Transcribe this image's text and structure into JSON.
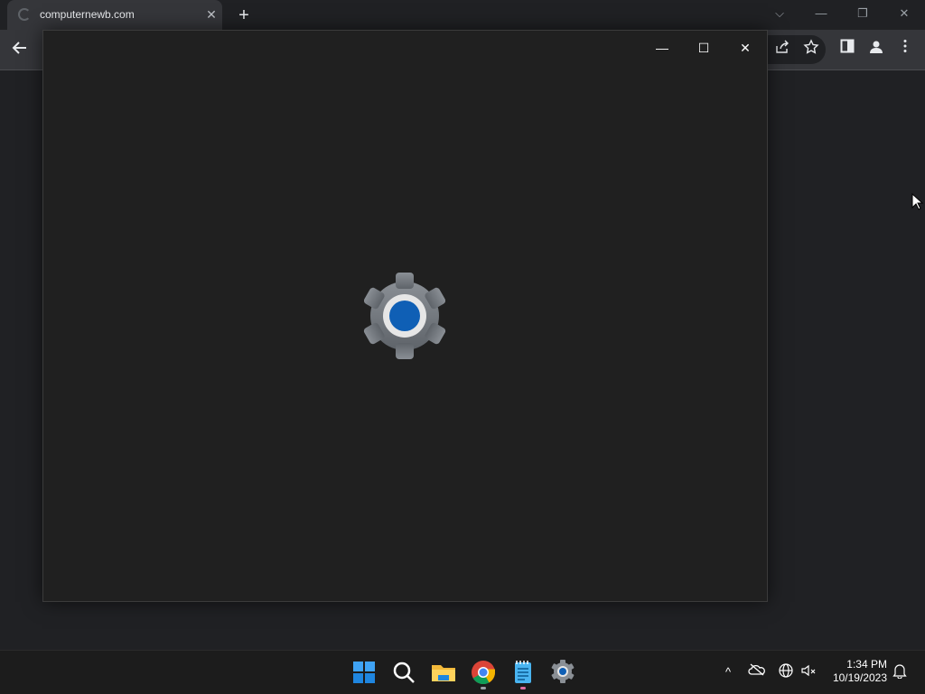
{
  "browser": {
    "tab_title": "computernewb.com",
    "tab_close_glyph": "✕",
    "new_tab_glyph": "+",
    "controls": {
      "dropdown": "⌵",
      "minimize": "—",
      "restore": "❐",
      "close": "✕"
    },
    "toolbar_icons": [
      "back-icon",
      "share-icon",
      "star-icon",
      "side-panel-icon",
      "profile-icon",
      "menu-icon"
    ]
  },
  "settings_window": {
    "controls": {
      "minimize": "—",
      "maximize": "☐",
      "close": "✕"
    },
    "splash_icon": "settings-gear-icon"
  },
  "taskbar": {
    "apps": [
      "start-icon",
      "search-icon",
      "file-explorer-icon",
      "chrome-icon",
      "notepad-icon",
      "settings-icon"
    ],
    "tray": {
      "chevron": "^",
      "time": "1:34 PM",
      "date": "10/19/2023"
    }
  },
  "colors": {
    "accent_blue": "#0f5fb5",
    "window_bg": "#202020",
    "taskbar_bg": "#1c1c1c"
  }
}
